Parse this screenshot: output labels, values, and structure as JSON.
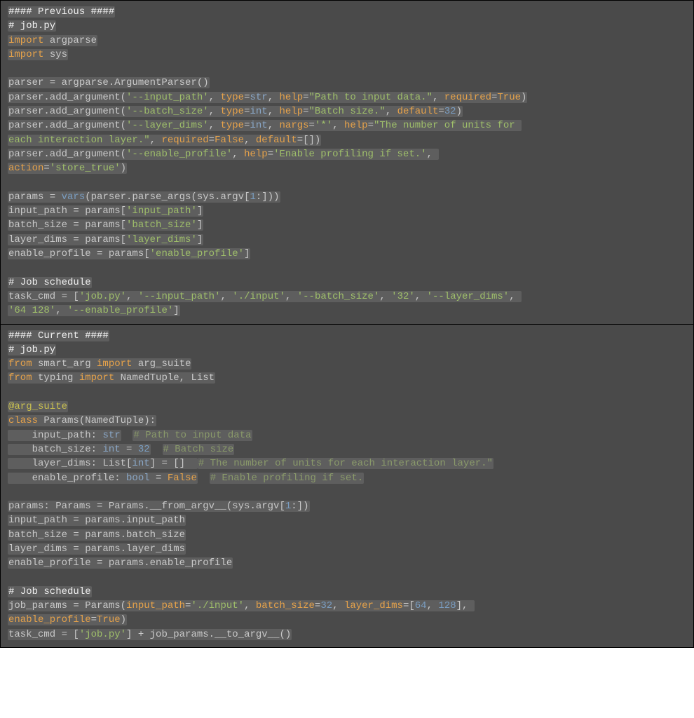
{
  "panel1": {
    "title": "#### Previous ####",
    "l1": "# job.py",
    "l2a": "import",
    "l2b": " argparse",
    "l3a": "import",
    "l3b": " sys",
    "l5": "parser = argparse.ArgumentParser()",
    "l6a": "parser.add_argument(",
    "l6b": "'--input_path'",
    "l6c": ", ",
    "l6d": "type",
    "l6e": "=",
    "l6f": "str",
    "l6g": ", ",
    "l6h": "help",
    "l6i": "=",
    "l6j": "\"Path to input data.\"",
    "l6k": ", ",
    "l6l": "required",
    "l6m": "=",
    "l6n": "True",
    "l6o": ")",
    "l7a": "parser.add_argument(",
    "l7b": "'--batch_size'",
    "l7c": ", ",
    "l7d": "type",
    "l7e": "=",
    "l7f": "int",
    "l7g": ", ",
    "l7h": "help",
    "l7i": "=",
    "l7j": "\"Batch size.\"",
    "l7k": ", ",
    "l7l": "default",
    "l7m": "=",
    "l7n": "32",
    "l7o": ")",
    "l8a": "parser.add_argument(",
    "l8b": "'--layer_dims'",
    "l8c": ", ",
    "l8d": "type",
    "l8e": "=",
    "l8f": "int",
    "l8g": ", ",
    "l8h": "nargs",
    "l8i": "=",
    "l8j": "'*'",
    "l8k": ", ",
    "l8l": "help",
    "l8m": "=",
    "l8n": "\"The number of units for ",
    "l9a": "each interaction layer.\"",
    "l9b": ", ",
    "l9c": "required",
    "l9d": "=",
    "l9e": "False",
    "l9f": ", ",
    "l9g": "default",
    "l9h": "=[])",
    "l10a": "parser.add_argument(",
    "l10b": "'--enable_profile'",
    "l10c": ", ",
    "l10d": "help",
    "l10e": "=",
    "l10f": "'Enable profiling if set.'",
    "l10g": ", ",
    "l11a": "action",
    "l11b": "=",
    "l11c": "'store_true'",
    "l11d": ")",
    "l13a": "params = ",
    "l13b": "vars",
    "l13c": "(parser.parse_args(sys.argv[",
    "l13d": "1",
    "l13e": ":]))",
    "l14a": "input_path = params[",
    "l14b": "'input_path'",
    "l14c": "]",
    "l15a": "batch_size = params[",
    "l15b": "'batch_size'",
    "l15c": "]",
    "l16a": "layer_dims = params[",
    "l16b": "'layer_dims'",
    "l16c": "]",
    "l17a": "enable_profile = params[",
    "l17b": "'enable_profile'",
    "l17c": "]",
    "l19": "# Job schedule",
    "l20a": "task_cmd = [",
    "l20b": "'job.py'",
    "l20c": ", ",
    "l20d": "'--input_path'",
    "l20e": ", ",
    "l20f": "'./input'",
    "l20g": ", ",
    "l20h": "'--batch_size'",
    "l20i": ", ",
    "l20j": "'32'",
    "l20k": ", ",
    "l20l": "'--layer_dims'",
    "l20m": ", ",
    "l21a": "'64 128'",
    "l21b": ", ",
    "l21c": "'--enable_profile'",
    "l21d": "]"
  },
  "panel2": {
    "title": "#### Current ####",
    "l1": "# job.py",
    "l2a": "from",
    "l2b": " smart_arg ",
    "l2c": "import",
    "l2d": " arg_suite",
    "l3a": "from",
    "l3b": " typing ",
    "l3c": "import",
    "l3d": " NamedTuple, List",
    "l5": "@arg_suite",
    "l6a": "class",
    "l6b": " Params",
    "l6c": "(NamedTuple):",
    "l7a": "    input_path: ",
    "l7b": "str",
    "l7c": "  ",
    "l7d": "# Path to input data",
    "l8a": "    batch_size: ",
    "l8b": "int",
    "l8c": " = ",
    "l8d": "32",
    "l8e": "  ",
    "l8f": "# Batch size",
    "l9a": "    layer_dims: List[",
    "l9b": "int",
    "l9c": "] = []  ",
    "l9d": "# The number of units for each interaction layer.\"",
    "l10a": "    enable_profile: ",
    "l10b": "bool",
    "l10c": " = ",
    "l10d": "False",
    "l10e": "  ",
    "l10f": "# Enable profiling if set.",
    "l12a": "params: Params = Params.__from_argv__(sys.argv[",
    "l12b": "1",
    "l12c": ":])",
    "l13": "input_path = params.input_path",
    "l14": "batch_size = params.batch_size",
    "l15": "layer_dims = params.layer_dims",
    "l16": "enable_profile = params.enable_profile",
    "l18": "# Job schedule",
    "l19a": "job_params = Params(",
    "l19b": "input_path",
    "l19c": "=",
    "l19d": "'./input'",
    "l19e": ", ",
    "l19f": "batch_size",
    "l19g": "=",
    "l19h": "32",
    "l19i": ", ",
    "l19j": "layer_dims",
    "l19k": "=[",
    "l19l": "64",
    "l19m": ", ",
    "l19n": "128",
    "l19o": "], ",
    "l20a": "enable_profile",
    "l20b": "=",
    "l20c": "True",
    "l20d": ")",
    "l21a": "task_cmd = [",
    "l21b": "'job.py'",
    "l21c": "] + job_params.__to_argv__()"
  }
}
